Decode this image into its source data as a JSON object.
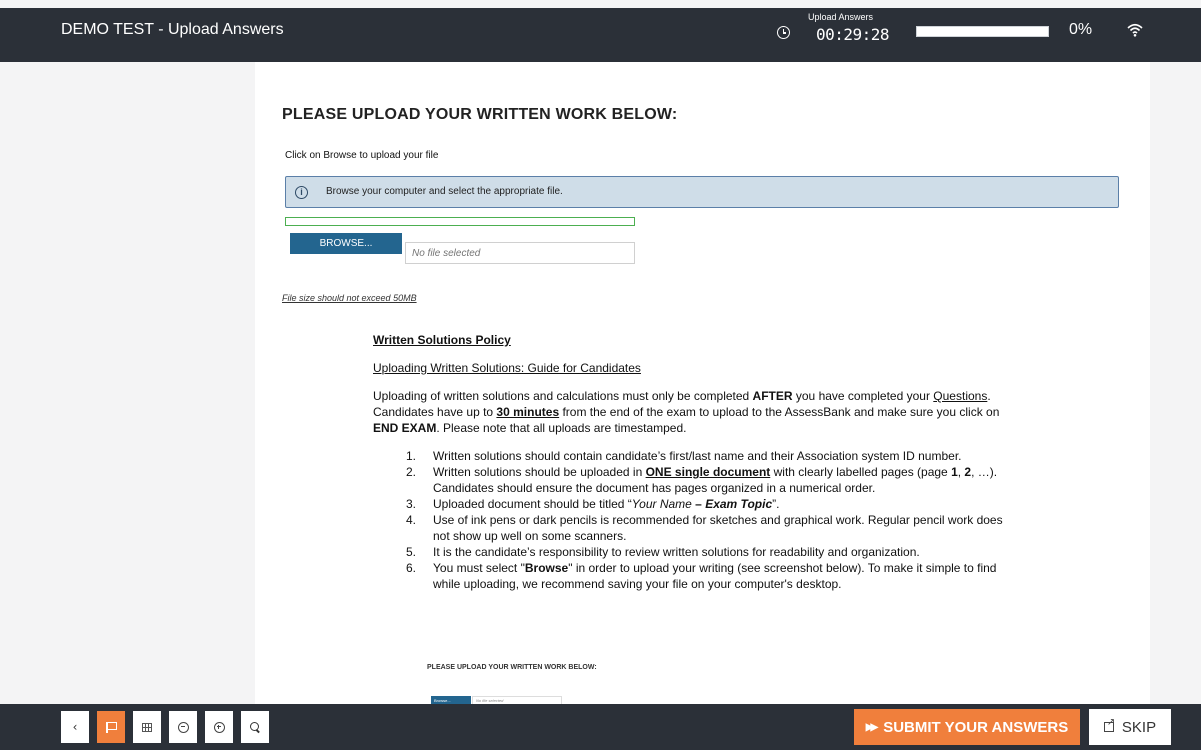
{
  "header": {
    "title": "DEMO TEST - Upload Answers",
    "timer_label": "Upload Answers",
    "timer_value": "00:29:28",
    "progress_fraction": 0,
    "progress_text": "0%"
  },
  "upload": {
    "heading": "PLEASE UPLOAD YOUR WRITTEN WORK BELOW:",
    "instruction": "Click on Browse to upload your file",
    "info_text": "Browse your computer and select the appropriate file.",
    "browse_label": "BROWSE...",
    "file_placeholder": "No file selected",
    "size_note": "File size should not exceed 50MB"
  },
  "policy": {
    "title": "Written Solutions Policy",
    "subtitle": "Uploading Written Solutions: Guide for Candidates",
    "intro_html": "Uploading of written solutions and calculations must only be completed <b>AFTER</b> you have completed your <u>Questions</u>. Candidates have up to <b><u>30 minutes</u></b> from the end of the exam to upload to the AssessBank and make sure you click on <b>END EXAM</b>. Please note that all uploads are timestamped.",
    "items": [
      {
        "num": "1.",
        "html": "Written solutions should contain candidate’s first/last name and their Association system ID number."
      },
      {
        "num": "2.",
        "html": "Written solutions should be uploaded in <b><u>ONE single document</u></b> with clearly labelled pages (page <b>1</b>, <b>2</b>, …). Candidates should ensure the document has pages organized in a numerical order."
      },
      {
        "num": "3.",
        "html": "Uploaded document should be titled “<i>Your Name</i> <b>–</b> <b><i>Exam Topic</i></b>”."
      },
      {
        "num": "4.",
        "html": "Use of ink pens or dark pencils is recommended for sketches and graphical work. Regular pencil work does not show up well on some scanners."
      },
      {
        "num": "5.",
        "html": "It is the candidate’s responsibility to review written solutions for readability and organization."
      },
      {
        "num": "6.",
        "html": "You must select \"<b>Browse</b>\" in order to upload your writing (see screenshot below). To make it simple to find while uploading, we recommend saving your file on your computer's desktop."
      }
    ],
    "example_heading": "PLEASE UPLOAD YOUR WRITTEN WORK BELOW:",
    "example_browse": "Browse...",
    "example_field": "No file selected"
  },
  "footer": {
    "submit_label": "SUBMIT YOUR ANSWERS",
    "skip_label": "SKIP"
  },
  "icons": [
    "clock-icon",
    "wifi-icon",
    "info-icon",
    "chevron-left-icon",
    "flag-icon",
    "grid-icon",
    "zoom-out-icon",
    "zoom-in-icon",
    "search-icon",
    "fast-forward-icon",
    "external-link-icon"
  ],
  "colors": {
    "bar": "#2b3038",
    "accent": "#f07f3c",
    "browse": "#23658f",
    "info_bg": "#cfdde8"
  }
}
